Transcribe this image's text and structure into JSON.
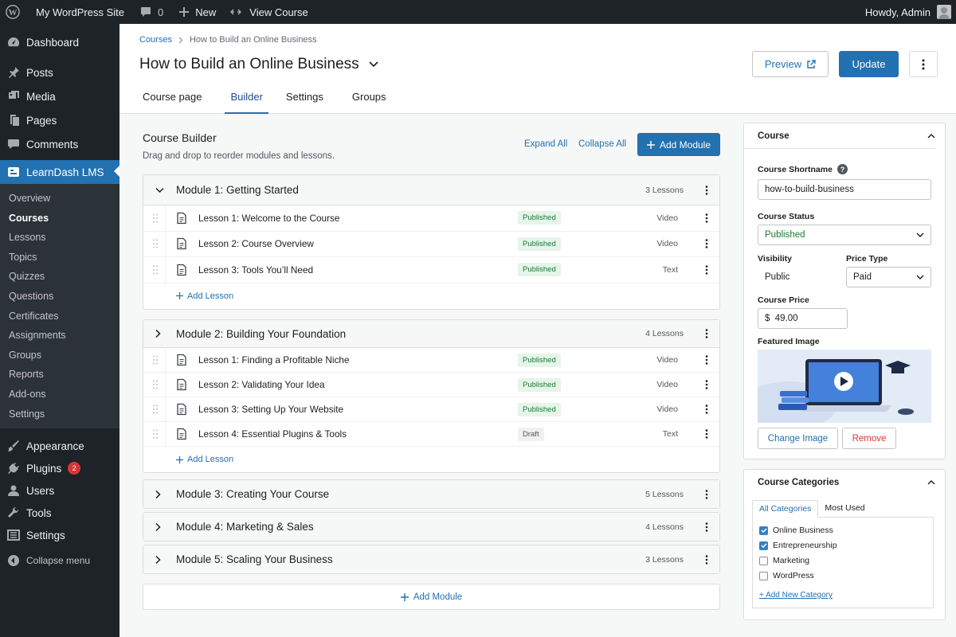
{
  "adminbar": {
    "site_name": "My WordPress Site",
    "comments_count": "0",
    "new_label": "New",
    "view_course_label": "View Course",
    "howdy": "Howdy, Admin"
  },
  "sidebar": {
    "dashboard": "Dashboard",
    "posts": "Posts",
    "media": "Media",
    "pages": "Pages",
    "comments": "Comments",
    "learndash": "LearnDash LMS",
    "submenu": [
      "Overview",
      "Courses",
      "Lessons",
      "Topics",
      "Quizzes",
      "Questions",
      "Certificates",
      "Assignments",
      "Groups",
      "Reports",
      "Add-ons",
      "Settings"
    ],
    "appearance": "Appearance",
    "plugins": "Plugins",
    "plugins_badge": "2",
    "users": "Users",
    "tools": "Tools",
    "settings": "Settings",
    "collapse": "Collapse menu"
  },
  "header": {
    "breadcrumb_root": "Courses",
    "breadcrumb_current": "How to Build an Online Business",
    "title": "How to Build an Online Business",
    "preview_label": "Preview",
    "update_label": "Update",
    "tabs": [
      "Course page",
      "Builder",
      "Settings",
      "Groups"
    ]
  },
  "builder": {
    "title": "Course Builder",
    "subtitle": "Drag and drop to reorder modules and lessons.",
    "expand_all": "Expand All",
    "collapse_all": "Collapse All",
    "add_module": "Add Module",
    "add_lesson": "Add Lesson",
    "add_module_bottom": "Add Module",
    "modules": [
      {
        "title": "Module 1: Getting Started",
        "count": "3 Lessons",
        "expanded": true,
        "lessons": [
          {
            "title": "Lesson 1: Welcome to the Course",
            "status": "Published",
            "type": "Video"
          },
          {
            "title": "Lesson 2: Course Overview",
            "status": "Published",
            "type": "Video"
          },
          {
            "title": "Lesson 3: Tools You’ll Need",
            "status": "Published",
            "type": "Text"
          }
        ]
      },
      {
        "title": "Module 2: Building Your Foundation",
        "count": "4 Lessons",
        "expanded": true,
        "lessons": [
          {
            "title": "Lesson 1: Finding a Profitable Niche",
            "status": "Published",
            "type": "Video"
          },
          {
            "title": "Lesson 2: Validating Your Idea",
            "status": "Published",
            "type": "Video"
          },
          {
            "title": "Lesson 3: Setting Up Your Website",
            "status": "Published",
            "type": "Video"
          },
          {
            "title": "Lesson 4: Essential Plugins & Tools",
            "status": "Draft",
            "type": "Text"
          }
        ]
      },
      {
        "title": "Module 3: Creating Your Course",
        "count": "5 Lessons",
        "expanded": false
      },
      {
        "title": "Module 4: Marketing & Sales",
        "count": "4 Lessons",
        "expanded": false
      },
      {
        "title": "Module 5: Scaling Your Business",
        "count": "3 Lessons",
        "expanded": false
      }
    ]
  },
  "course_panel": {
    "title": "Course",
    "shortname_label": "Course Shortname",
    "shortname_value": "how-to-build-business",
    "status_label": "Course Status",
    "status_value": "Published",
    "visibility_label": "Visibility",
    "visibility_value": "Public",
    "price_type_label": "Price Type",
    "price_type_value": "Paid",
    "price_label": "Course Price",
    "price_value": "$  49.00",
    "featured_label": "Featured Image",
    "change_image": "Change Image",
    "remove": "Remove"
  },
  "categories_panel": {
    "title": "Course Categories",
    "tab_all": "All Categories",
    "tab_most_used": "Most Used",
    "items": [
      {
        "label": "Online Business",
        "checked": true
      },
      {
        "label": "Entrepreneurship",
        "checked": true
      },
      {
        "label": "Marketing",
        "checked": false
      },
      {
        "label": "WordPress",
        "checked": false
      }
    ],
    "add_new": "+ Add New Category"
  },
  "colors": {
    "accent": "#2271b1",
    "admin_dark": "#1d2327",
    "published_bg": "#e6f4ea",
    "published_text": "#1b7a36",
    "remove_red": "#d63638"
  }
}
